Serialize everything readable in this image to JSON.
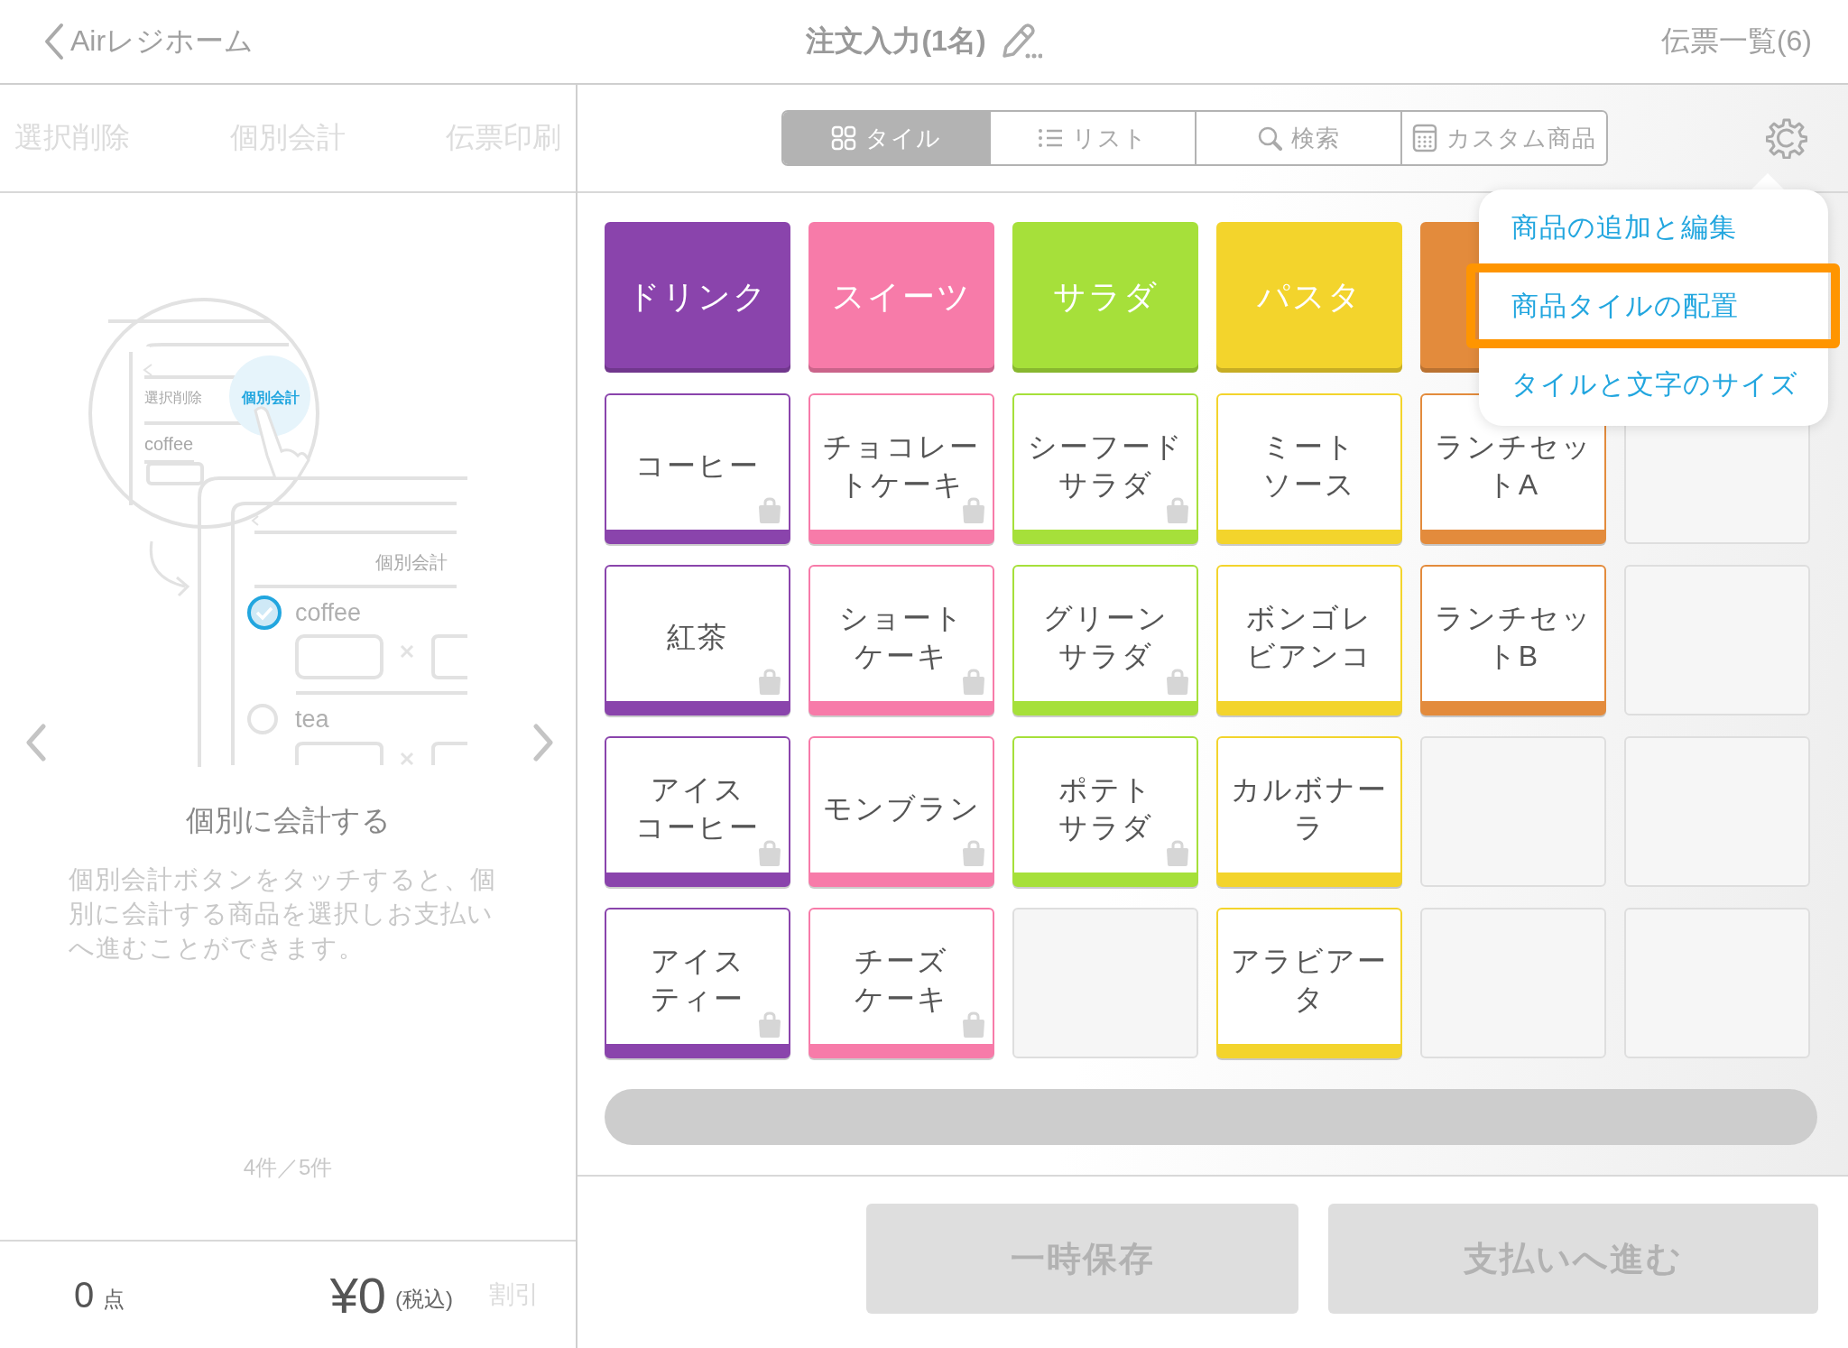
{
  "header": {
    "back_label": "Airレジホーム",
    "title": "注文入力(1名)",
    "slip_list": "伝票一覧(6)"
  },
  "left_toolbar": [
    {
      "label": "選択削除",
      "disabled": true
    },
    {
      "label": "個別会計",
      "disabled": true
    },
    {
      "label": "伝票印刷",
      "disabled": true
    }
  ],
  "guide": {
    "illustration_texts": [
      "選択削除",
      "個別会計",
      "coffee",
      "個別会計",
      "coffee",
      "tea"
    ],
    "title": "個別に会計する",
    "description": "個別会計ボタンをタッチすると、個別に会計する商品を選択しお支払いへ進むことができます。",
    "page": "4件／5件"
  },
  "summary": {
    "count": "0",
    "count_unit": "点",
    "total": "¥0",
    "tax_note": "(税込)",
    "discount": {
      "label": "割引",
      "disabled": true
    }
  },
  "view_tabs": [
    {
      "label": "タイル",
      "selected": true
    },
    {
      "label": "リスト",
      "selected": false
    },
    {
      "label": "検索",
      "selected": false
    },
    {
      "label": "カスタム商品",
      "selected": false
    }
  ],
  "tile_rows": [
    [
      {
        "kind": "category",
        "lines": [
          "ドリンク"
        ],
        "color": "#8a44ac"
      },
      {
        "kind": "category",
        "lines": [
          "スイーツ"
        ],
        "color": "#f77ba9"
      },
      {
        "kind": "category",
        "lines": [
          "サラダ"
        ],
        "color": "#a6e03a"
      },
      {
        "kind": "category",
        "lines": [
          "パスタ"
        ],
        "color": "#f3d42c"
      },
      {
        "kind": "category",
        "color": "#e38b3c"
      }
    ],
    [
      {
        "kind": "product",
        "lines": [
          "コーヒー"
        ],
        "color": "#8a44ac",
        "bag_icon": true
      },
      {
        "kind": "product",
        "lines": [
          "チョコレー",
          "トケーキ"
        ],
        "color": "#f77ba9",
        "bag_icon": true
      },
      {
        "kind": "product",
        "lines": [
          "シーフード",
          "サラダ"
        ],
        "color": "#a6e03a",
        "bag_icon": true
      },
      {
        "kind": "product",
        "lines": [
          "ミート",
          "ソース"
        ],
        "color": "#f3d42c",
        "bag_icon": false
      },
      {
        "kind": "product",
        "lines": [
          "ランチセッ",
          "トA"
        ],
        "color": "#e38b3c",
        "bag_icon": false
      },
      {
        "kind": "empty"
      }
    ],
    [
      {
        "kind": "product",
        "lines": [
          "紅茶"
        ],
        "color": "#8a44ac",
        "bag_icon": true
      },
      {
        "kind": "product",
        "lines": [
          "ショート",
          "ケーキ"
        ],
        "color": "#f77ba9",
        "bag_icon": true
      },
      {
        "kind": "product",
        "lines": [
          "グリーン",
          "サラダ"
        ],
        "color": "#a6e03a",
        "bag_icon": true
      },
      {
        "kind": "product",
        "lines": [
          "ボンゴレ",
          "ビアンコ"
        ],
        "color": "#f3d42c",
        "bag_icon": false
      },
      {
        "kind": "product",
        "lines": [
          "ランチセッ",
          "トB"
        ],
        "color": "#e38b3c",
        "bag_icon": false
      },
      {
        "kind": "empty"
      }
    ],
    [
      {
        "kind": "product",
        "lines": [
          "アイス",
          "コーヒー"
        ],
        "color": "#8a44ac",
        "bag_icon": true
      },
      {
        "kind": "product",
        "lines": [
          "モンブラン"
        ],
        "color": "#f77ba9",
        "bag_icon": true
      },
      {
        "kind": "product",
        "lines": [
          "ポテト",
          "サラダ"
        ],
        "color": "#a6e03a",
        "bag_icon": true
      },
      {
        "kind": "product",
        "lines": [
          "カルボナー",
          "ラ"
        ],
        "color": "#f3d42c",
        "bag_icon": false
      },
      {
        "kind": "empty"
      },
      {
        "kind": "empty"
      }
    ],
    [
      {
        "kind": "product",
        "lines": [
          "アイス",
          "ティー"
        ],
        "color": "#8a44ac",
        "bag_icon": true
      },
      {
        "kind": "product",
        "lines": [
          "チーズ",
          "ケーキ"
        ],
        "color": "#f77ba9",
        "bag_icon": true
      },
      {
        "kind": "empty"
      },
      {
        "kind": "product",
        "lines": [
          "アラビアー",
          "タ"
        ],
        "color": "#f3d42c",
        "bag_icon": false
      },
      {
        "kind": "empty"
      },
      {
        "kind": "empty"
      }
    ]
  ],
  "settings_menu": [
    {
      "label": "商品の追加と編集",
      "highlighted": false
    },
    {
      "label": "商品タイルの配置",
      "highlighted": true
    },
    {
      "label": "タイルと文字のサイズ",
      "highlighted": false
    }
  ],
  "actions": [
    {
      "label": "一時保存",
      "disabled": true
    },
    {
      "label": "支払いへ進む",
      "disabled": true
    }
  ]
}
